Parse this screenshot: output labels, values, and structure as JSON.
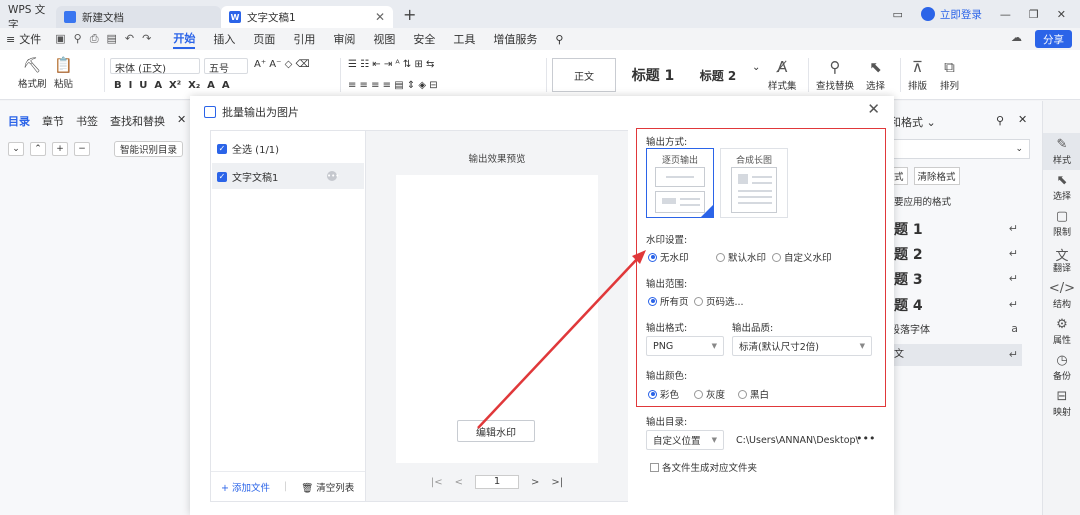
{
  "titlebar": {
    "app_name": "WPS 文字",
    "tab1": "新建文档",
    "tab2": "文字文稿1",
    "login": "立即登录"
  },
  "menubar": {
    "file": "文件",
    "items": [
      "开始",
      "插入",
      "页面",
      "引用",
      "审阅",
      "视图",
      "安全",
      "工具",
      "增值服务"
    ],
    "share": "分享"
  },
  "ribbon": {
    "format_painter": "格式刷",
    "paste": "粘贴",
    "font": "宋体 (正文)",
    "size": "五号",
    "style_normal": "正文",
    "style_h1": "标题  1",
    "style_h2": "标题  2",
    "style_set": "样式集",
    "find": "查找替换",
    "select": "选择",
    "layout": "排版",
    "arrange": "排列"
  },
  "leftpane": {
    "tabs": [
      "目录",
      "章节",
      "书签",
      "查找和替换"
    ],
    "smart": "智能识别目录"
  },
  "rightpane": {
    "title": "和格式",
    "clear": "清除格式",
    "used": "要应用的格式",
    "headings": [
      "题  1",
      "题  2",
      "题  3",
      "题  4"
    ],
    "para_font": "段落字体",
    "body": "文"
  },
  "sidebar": [
    "样式",
    "选择",
    "限制",
    "翻译",
    "结构",
    "属性",
    "备份",
    "映射"
  ],
  "dialog": {
    "title": "批量输出为图片",
    "select_all": "全选 (1/1)",
    "file1": "文字文稿1",
    "add_file": "添加文件",
    "clear_list": "清空列表",
    "preview_label": "输出效果预览",
    "edit_watermark": "编辑水印",
    "page_num": "1",
    "output_mode_label": "输出方式:",
    "mode_single": "逐页输出",
    "mode_long": "合成长图",
    "watermark_label": "水印设置:",
    "wm_none": "无水印",
    "wm_default": "默认水印",
    "wm_custom": "自定义水印",
    "range_label": "输出范围:",
    "range_all": "所有页",
    "range_select": "页码选...",
    "format_label": "输出格式:",
    "format_value": "PNG",
    "quality_label": "输出品质:",
    "quality_value": "标清(默认尺寸2倍)",
    "color_label": "输出颜色:",
    "color_color": "彩色",
    "color_gray": "灰度",
    "color_bw": "黑白",
    "dir_label": "输出目录:",
    "dir_mode": "自定义位置",
    "dir_path": "C:\\Users\\ANNAN\\Desktop\\",
    "subfolder": "各文件生成对应文件夹"
  }
}
